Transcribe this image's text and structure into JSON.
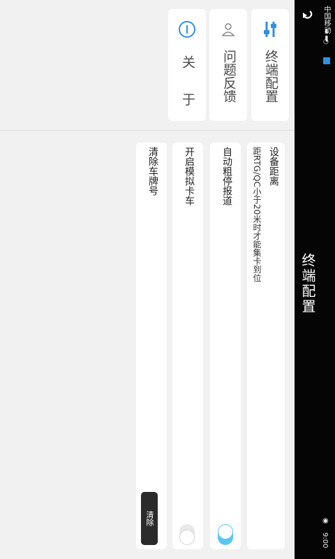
{
  "status": {
    "carrier": "中国移动",
    "time": "9:00"
  },
  "header": {
    "title": "终端配置"
  },
  "quick": {
    "config": "终端配置",
    "feedback": "问题反馈",
    "about": "关 于"
  },
  "settings": {
    "device_distance": {
      "title": "设备距离",
      "desc": "距RTG/QC小于20米时才能集卡到位"
    },
    "auto_report": {
      "title": "自动粗停报道",
      "enabled": true
    },
    "simulate_truck": {
      "title": "开启模拟卡车",
      "enabled": false
    },
    "clear_plate": {
      "title": "清除车牌号",
      "button": "清除"
    }
  },
  "colors": {
    "accent": "#2f8fe6",
    "toggle_on": "#5bc6f3",
    "titlebar": "#050505"
  }
}
